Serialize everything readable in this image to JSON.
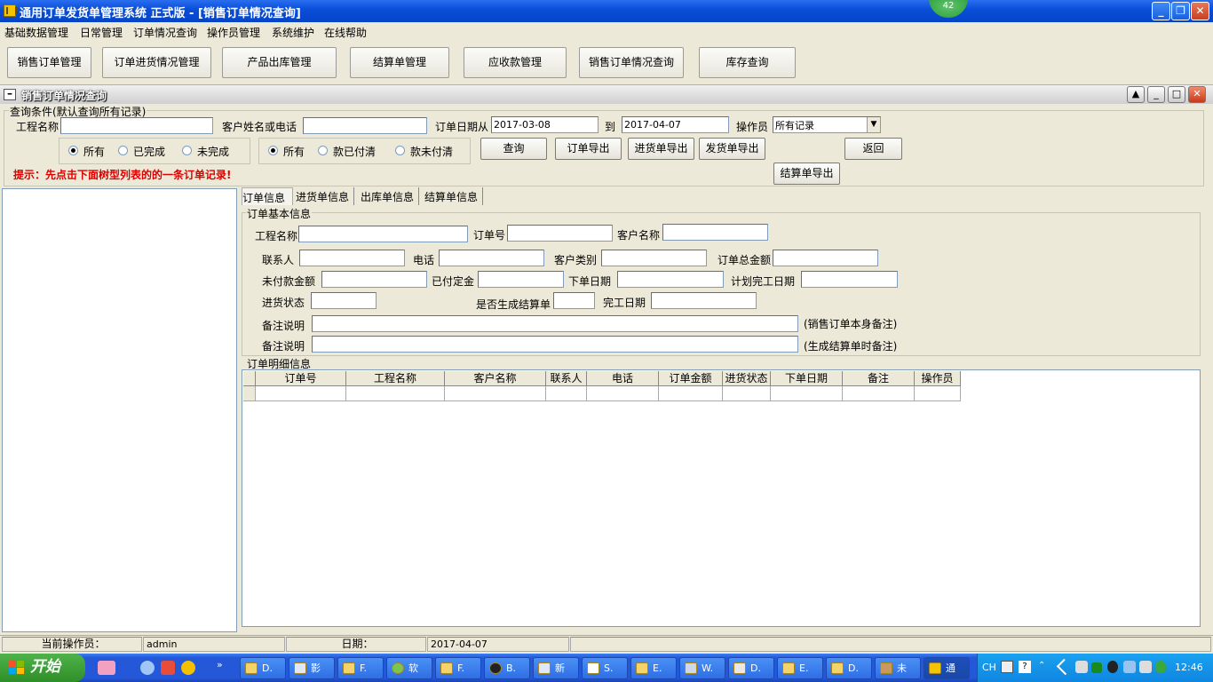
{
  "window": {
    "title": "通用订单发货单管理系统 正式版  - [销售订单情况查询]",
    "badge": "42"
  },
  "menu": [
    "基础数据管理",
    "日常管理",
    "订单情况查询",
    "操作员管理",
    "系统维护",
    "在线帮助"
  ],
  "toolbar": [
    "销售订单管理",
    "订单进货情况管理",
    "产品出库管理",
    "结算单管理",
    "应收款管理",
    "销售订单情况查询",
    "库存查询"
  ],
  "child_title": "销售订单情况查询",
  "query": {
    "group_title": "查询条件(默认查询所有记录)",
    "project_label": "工程名称",
    "customer_label": "客户姓名或电话",
    "date_from_label": "订单日期从",
    "date_from": "2017-03-08",
    "date_to_label": "到",
    "date_to": "2017-04-07",
    "operator_label": "操作员",
    "operator_value": "所有记录",
    "status_radios": [
      "所有",
      "已完成",
      "未完成"
    ],
    "pay_radios": [
      "所有",
      "款已付清",
      "款未付清"
    ],
    "btn_query": "查询",
    "btn_export_order": "订单导出",
    "btn_export_purchase": "进货单导出",
    "btn_export_delivery": "发货单导出",
    "btn_back": "返回",
    "btn_export_settle": "结算单导出",
    "hint": "提示：先点击下面树型列表的的一条订单记录!"
  },
  "tabs": [
    "订单信息",
    "进货单信息",
    "出库单信息",
    "结算单信息"
  ],
  "basic": {
    "group_title": "订单基本信息",
    "project": "工程名称",
    "order_no": "订单号",
    "customer": "客户名称",
    "contact": "联系人",
    "phone": "电话",
    "customer_type": "客户类别",
    "total": "订单总金额",
    "unpaid": "未付款金额",
    "deposit": "已付定金",
    "order_date": "下单日期",
    "plan_date": "计划完工日期",
    "purchase_status": "进货状态",
    "gen_settle": "是否生成结算单",
    "finish_date": "完工日期",
    "remark1": "备注说明",
    "remark1_note": "(销售订单本身备注)",
    "remark2": "备注说明",
    "remark2_note": "(生成结算单时备注)"
  },
  "detail": {
    "group_title": "订单明细信息",
    "columns": [
      "订单号",
      "工程名称",
      "客户名称",
      "联系人",
      "电话",
      "订单金额",
      "进货状态",
      "下单日期",
      "备注",
      "操作员"
    ]
  },
  "status": {
    "operator_label": "当前操作员：",
    "operator": "admin",
    "date_label": "日期：",
    "date": "2017-04-07"
  },
  "taskbar": {
    "start": "开始",
    "tasks": [
      "D.",
      "影",
      "F.",
      "软",
      "F.",
      "B.",
      "新",
      "S.",
      "E.",
      "W.",
      "D.",
      "E.",
      "D.",
      "未",
      "通"
    ],
    "tray_lang": "CH",
    "clock": "12:46"
  }
}
